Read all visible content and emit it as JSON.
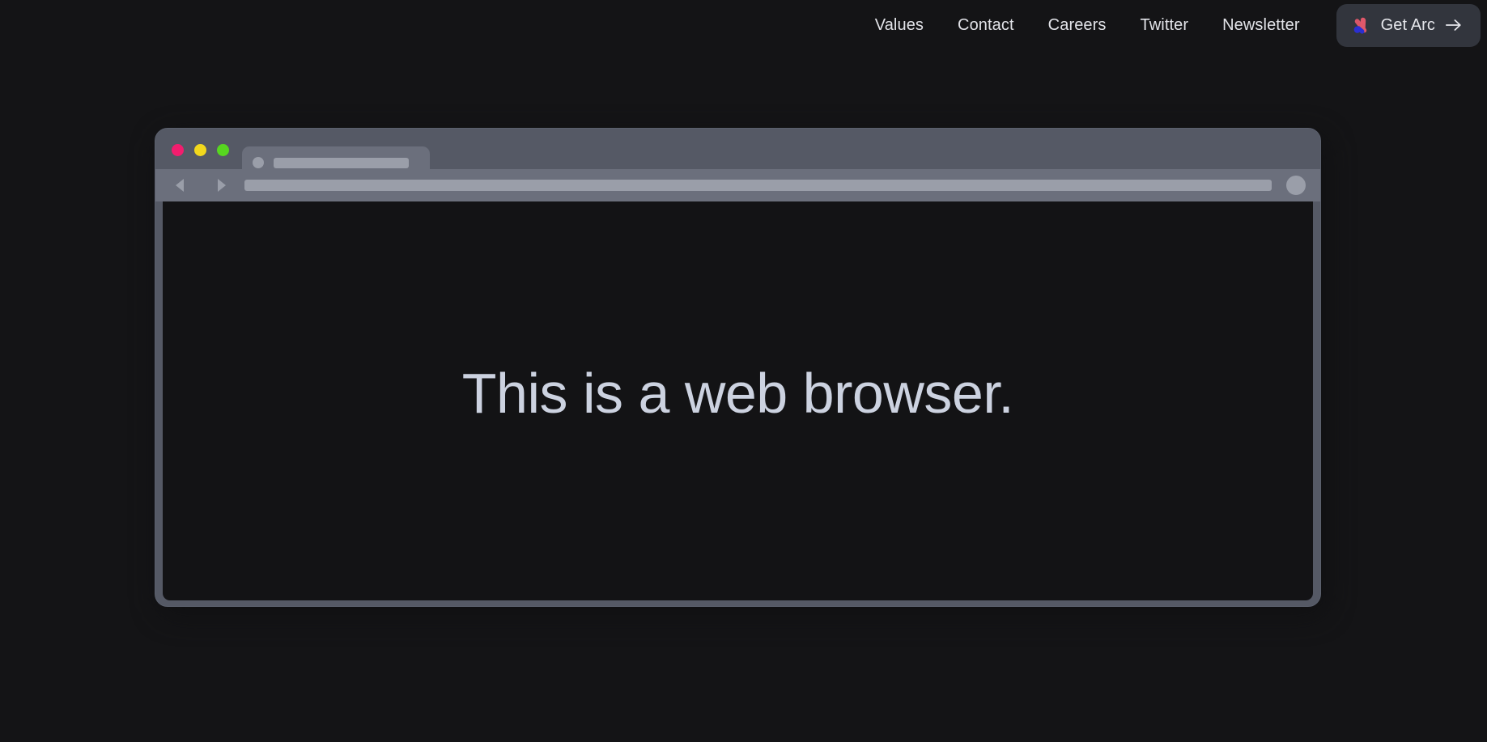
{
  "theme": {
    "page_background": "#141416",
    "nav_text": "#e2e3e8",
    "button_background": "#32353d",
    "window_frame": "#555965",
    "toolbar": "#6b6f7c",
    "chrome_placeholder": "#9a9ea9",
    "viewport_background": "#131315",
    "headline_color": "#ccd2e0",
    "traffic_red": "#f21d6e",
    "traffic_yellow": "#f2d81d",
    "traffic_green": "#57d620",
    "arc_logo_blue": "#2b2fd0",
    "arc_logo_red": "#e0586a"
  },
  "topnav": {
    "links": [
      {
        "label": "Values"
      },
      {
        "label": "Contact"
      },
      {
        "label": "Careers"
      },
      {
        "label": "Twitter"
      },
      {
        "label": "Newsletter"
      }
    ],
    "cta": {
      "label": "Get Arc",
      "logo_icon": "arc-logo-icon",
      "arrow_icon": "arrow-right-icon"
    }
  },
  "browser_mockup": {
    "traffic_lights": [
      {
        "name": "close",
        "color": "#f21d6e"
      },
      {
        "name": "minimize",
        "color": "#f2d81d"
      },
      {
        "name": "maximize",
        "color": "#57d620"
      }
    ],
    "tab": {
      "favicon_icon": "favicon-placeholder-icon",
      "title_placeholder": ""
    },
    "toolbar": {
      "back_icon": "chevron-left-icon",
      "forward_icon": "chevron-right-icon",
      "address_placeholder": "",
      "profile_icon": "profile-circle-icon"
    },
    "viewport": {
      "headline": "This is a web browser."
    }
  }
}
